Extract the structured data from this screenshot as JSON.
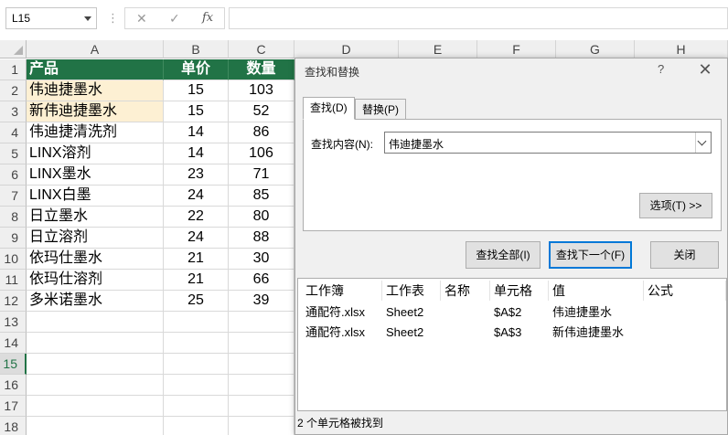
{
  "formula_bar": {
    "namebox": "L15",
    "cancel_icon": "✕",
    "enter_icon": "✓",
    "fx_label": "fx",
    "separator": "⋮",
    "formula": ""
  },
  "sheet": {
    "columns": [
      "A",
      "B",
      "C",
      "D",
      "E",
      "F",
      "G",
      "H"
    ],
    "rows": [
      "1",
      "2",
      "3",
      "4",
      "5",
      "6",
      "7",
      "8",
      "9",
      "10",
      "11",
      "12",
      "13",
      "14",
      "15",
      "16",
      "17",
      "18"
    ],
    "active_row": "15",
    "header_row": [
      "产品",
      "单价",
      "数量"
    ],
    "data": [
      [
        "伟迪捷墨水",
        "15",
        "103"
      ],
      [
        "新伟迪捷墨水",
        "15",
        "52"
      ],
      [
        "伟迪捷清洗剂",
        "14",
        "86"
      ],
      [
        "LINX溶剂",
        "14",
        "106"
      ],
      [
        "LINX墨水",
        "23",
        "71"
      ],
      [
        "LINX白墨",
        "24",
        "85"
      ],
      [
        "日立墨水",
        "22",
        "80"
      ],
      [
        "日立溶剂",
        "24",
        "88"
      ],
      [
        "依玛仕墨水",
        "21",
        "30"
      ],
      [
        "依玛仕溶剂",
        "21",
        "66"
      ],
      [
        "多米诺墨水",
        "25",
        "39"
      ]
    ],
    "header_color": "#217346",
    "highlight_color": "#fdf0d3"
  },
  "dialog": {
    "title": "查找和替换",
    "help": "?",
    "close_icon": "✕",
    "tabs": [
      "查找(D)",
      "替换(P)"
    ],
    "find_label": "查找内容(N):",
    "find_value": "伟迪捷墨水",
    "options_button": "选项(T) >>",
    "find_all_button": "查找全部(I)",
    "find_next_button": "查找下一个(F)",
    "close_button": "关闭",
    "results_headers": [
      "工作簿",
      "工作表",
      "名称",
      "单元格",
      "值",
      "公式"
    ],
    "results": [
      [
        "通配符.xlsx",
        "Sheet2",
        "",
        "$A$2",
        "伟迪捷墨水",
        ""
      ],
      [
        "通配符.xlsx",
        "Sheet2",
        "",
        "$A$3",
        "新伟迪捷墨水",
        ""
      ]
    ],
    "status": "2 个单元格被找到",
    "accent_color": "#0078d7"
  }
}
